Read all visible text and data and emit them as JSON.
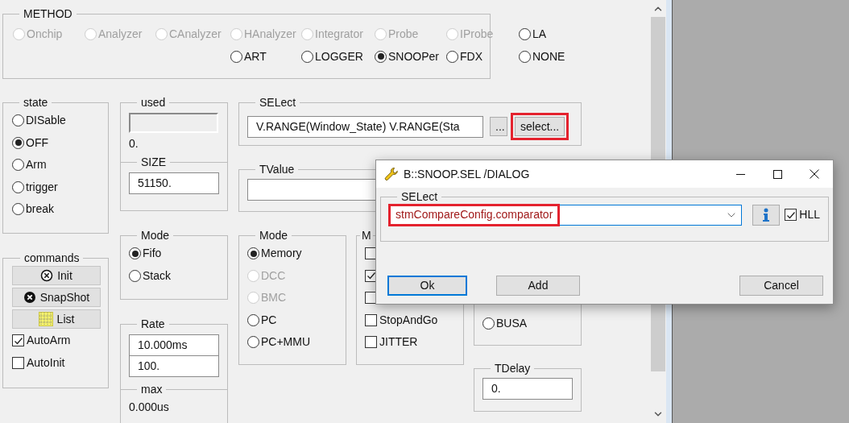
{
  "method": {
    "title": "METHOD",
    "rows": [
      [
        {
          "label": "Onchip",
          "disabled": true,
          "selected": false
        },
        {
          "label": "Analyzer",
          "disabled": true,
          "selected": false
        },
        {
          "label": "CAnalyzer",
          "disabled": true,
          "selected": false
        },
        {
          "label": "HAnalyzer",
          "disabled": true,
          "selected": false
        },
        {
          "label": "Integrator",
          "disabled": true,
          "selected": false
        },
        {
          "label": "Probe",
          "disabled": true,
          "selected": false
        },
        {
          "label": "IProbe",
          "disabled": true,
          "selected": false
        },
        {
          "label": "LA",
          "disabled": false,
          "selected": false
        }
      ],
      [
        "",
        "",
        "",
        {
          "label": "ART",
          "disabled": false,
          "selected": false
        },
        {
          "label": "LOGGER",
          "disabled": false,
          "selected": false
        },
        {
          "label": "SNOOPer",
          "disabled": false,
          "selected": true
        },
        {
          "label": "FDX",
          "disabled": false,
          "selected": false
        },
        {
          "label": "NONE",
          "disabled": false,
          "selected": false
        }
      ]
    ]
  },
  "state": {
    "title": "state",
    "options": [
      {
        "label": "DISable",
        "disabled": false,
        "selected": false
      },
      {
        "label": "OFF",
        "disabled": false,
        "selected": true
      },
      {
        "label": "Arm",
        "disabled": false,
        "selected": false
      },
      {
        "label": "trigger",
        "disabled": false,
        "selected": false
      },
      {
        "label": "break",
        "disabled": false,
        "selected": false
      }
    ]
  },
  "commands": {
    "title": "commands",
    "buttons": [
      {
        "label": "Init",
        "kind": "clear"
      },
      {
        "label": "SnapShot",
        "kind": "snapshot"
      },
      {
        "label": "List",
        "kind": "list"
      }
    ],
    "checkboxes": [
      {
        "label": "AutoArm",
        "checked": true
      },
      {
        "label": "AutoInit",
        "checked": false
      }
    ]
  },
  "used": {
    "title": "used",
    "level": 0,
    "value": "0."
  },
  "size": {
    "title": "SIZE",
    "value": "51150."
  },
  "buffer_mode": {
    "title": "Mode",
    "options": [
      {
        "label": "Fifo",
        "disabled": false,
        "selected": true
      },
      {
        "label": "Stack",
        "disabled": false,
        "selected": false
      }
    ]
  },
  "rate": {
    "title": "Rate",
    "values": [
      "10.000ms",
      "100."
    ]
  },
  "max": {
    "title": "max",
    "value": "0.000us"
  },
  "select": {
    "title": "SELect",
    "value": "V.RANGE(Window_State) V.RANGE(Sta",
    "buttons": [
      {
        "label": "...",
        "highlighted": false
      },
      {
        "label": "select...",
        "highlighted": true
      }
    ]
  },
  "tvalue": {
    "title": "TValue"
  },
  "mode": {
    "title": "Mode",
    "options": [
      {
        "label": "Memory",
        "disabled": false,
        "selected": true
      },
      {
        "label": "DCC",
        "disabled": true,
        "selected": false
      },
      {
        "label": "BMC",
        "disabled": true,
        "selected": false
      },
      {
        "label": "PC",
        "disabled": false,
        "selected": false
      },
      {
        "label": "PC+MMU",
        "disabled": false,
        "selected": false
      }
    ]
  },
  "flags": {
    "title": "M",
    "checkboxes": [
      {
        "checked": false
      },
      {
        "checked": true
      },
      {
        "checked": false
      },
      {
        "label": "StopAndGo",
        "checked": false
      },
      {
        "label": "JITTER",
        "checked": false
      }
    ]
  },
  "bus": {
    "options": [
      {
        "label": "BUSA",
        "selected": false
      }
    ]
  },
  "tdelay": {
    "title": "TDelay",
    "value": "0."
  },
  "dialog": {
    "title": "B::SNOOP.SEL /DIALOG",
    "group_title": "SELect",
    "value": "stmCompareConfig.comparator",
    "value_highlighted": true,
    "hll": {
      "label": "HLL",
      "checked": true
    },
    "buttons": [
      {
        "label": "Ok",
        "default": true
      },
      {
        "label": "Add",
        "default": false
      },
      {
        "label": "Cancel",
        "default": false
      }
    ]
  }
}
